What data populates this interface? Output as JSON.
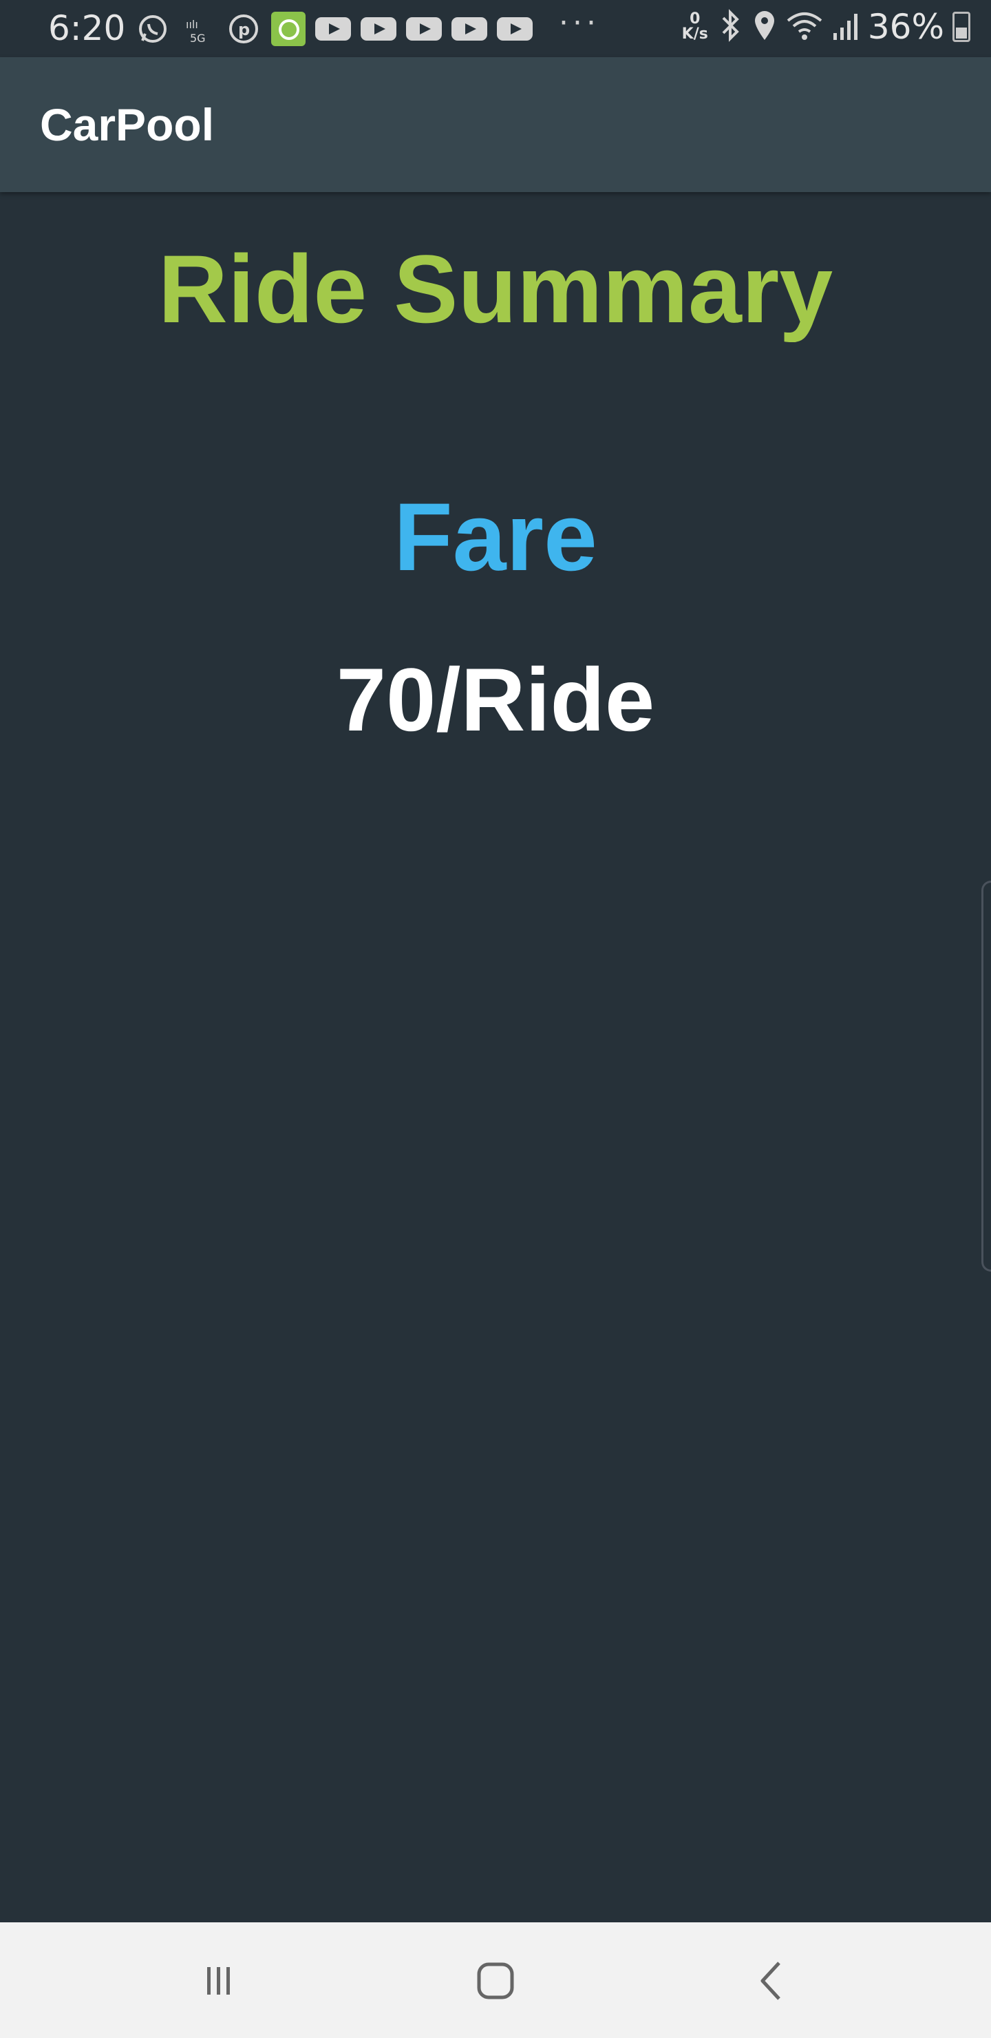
{
  "status_bar": {
    "time": "6:20",
    "network_speed_top": "0",
    "network_speed_unit": "K/s",
    "battery_percent": "36%",
    "more": "···"
  },
  "app_bar": {
    "title": "CarPool"
  },
  "summary": {
    "title": "Ride Summary",
    "fare_label": "Fare",
    "fare_value": "70/Ride"
  },
  "colors": {
    "background": "#263139",
    "app_bar": "#37474f",
    "title_green": "#a3c94a",
    "fare_blue": "#3fb5ee",
    "text_white": "#ffffff",
    "nav_bar": "#f2f2f2"
  },
  "nav": {
    "recent_icon": "recent-apps-icon",
    "home_icon": "home-icon",
    "back_icon": "back-icon"
  }
}
